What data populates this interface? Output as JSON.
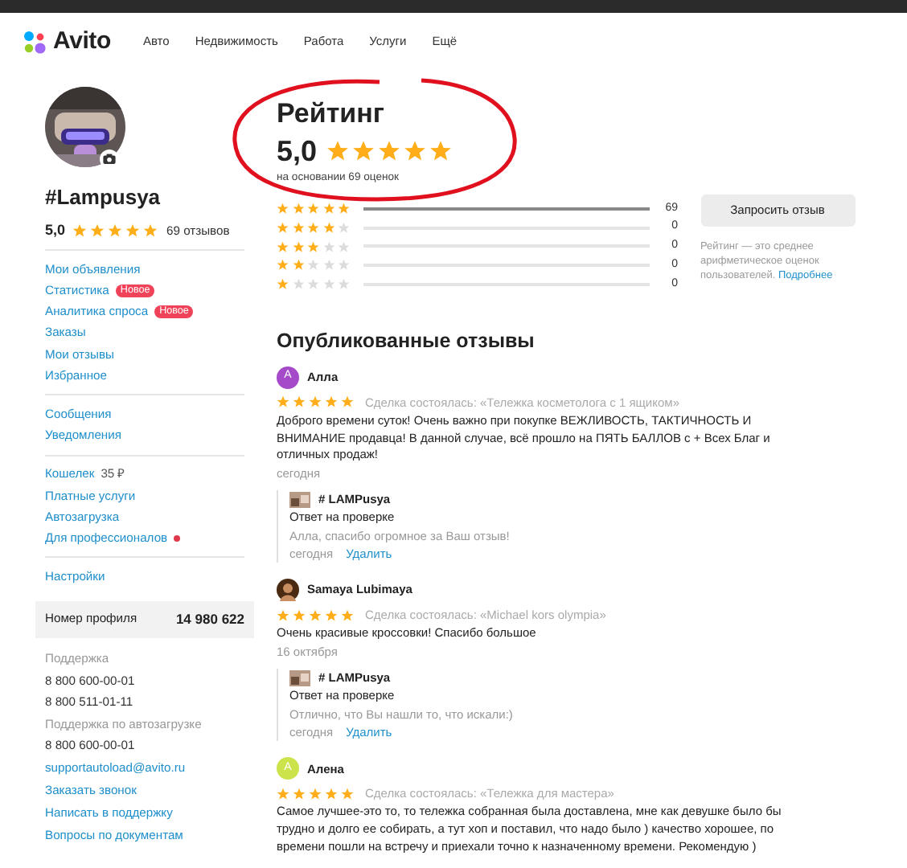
{
  "header": {
    "logo": "Avito",
    "nav": [
      "Авто",
      "Недвижимость",
      "Работа",
      "Услуги",
      "Ещё"
    ]
  },
  "profile": {
    "name": "#Lampusya",
    "score": "5,0",
    "stars": 5,
    "reviews_count": "69 отзывов"
  },
  "menu_groups": [
    [
      {
        "label": "Мои объявления"
      },
      {
        "label": "Статистика",
        "badge": "Новое"
      },
      {
        "label": "Аналитика спроса",
        "badge": "Новое"
      },
      {
        "label": "Заказы"
      },
      {
        "label": "Мои отзывы"
      },
      {
        "label": "Избранное"
      }
    ],
    [
      {
        "label": "Сообщения"
      },
      {
        "label": "Уведомления"
      }
    ],
    [
      {
        "label": "Кошелек",
        "value": "35 ₽"
      },
      {
        "label": "Платные услуги"
      },
      {
        "label": "Автозагрузка"
      },
      {
        "label": "Для профессионалов",
        "dot": true
      }
    ],
    [
      {
        "label": "Настройки"
      }
    ]
  ],
  "profile_number": {
    "label": "Номер профиля",
    "value": "14 980 622"
  },
  "support": [
    {
      "kind": "label",
      "text": "Поддержка"
    },
    {
      "kind": "phone",
      "text": "8 800 600-00-01"
    },
    {
      "kind": "phone",
      "text": "8 800 511-01-11"
    },
    {
      "kind": "label",
      "text": "Поддержка по автозагрузке"
    },
    {
      "kind": "phone",
      "text": "8 800 600-00-01"
    },
    {
      "kind": "link",
      "text": "supportautoload@avito.ru"
    },
    {
      "kind": "link",
      "text": "Заказать звонок"
    },
    {
      "kind": "link",
      "text": "Написать в поддержку"
    },
    {
      "kind": "link",
      "text": "Вопросы по документам"
    }
  ],
  "rating": {
    "title": "Рейтинг",
    "score": "5,0",
    "stars": 5,
    "caption": "на основании 69 оценок",
    "distribution": [
      {
        "stars": 5,
        "level": 1,
        "count": "69"
      },
      {
        "stars": 4,
        "level": 0,
        "count": "0"
      },
      {
        "stars": 3,
        "level": 0,
        "count": "0"
      },
      {
        "stars": 2,
        "level": 0,
        "count": "0"
      },
      {
        "stars": 1,
        "level": 0,
        "count": "0"
      }
    ],
    "button": "Запросить отзыв",
    "note": "Рейтинг — это среднее арифметическое оценок пользователей.",
    "note_link": "Подробнее"
  },
  "reviews_title": "Опубликованные отзывы",
  "reviews": [
    {
      "author": "Алла",
      "kind": "letter",
      "letter": "А",
      "color": "#a54bc9",
      "stars": 5,
      "deal": "Сделка состоялась: «Тележка косметолога с 1 ящиком»",
      "text": "Доброго времени суток! Очень важно при покупке ВЕЖЛИВОСТЬ, ТАКТИЧНОСТЬ И ВНИМАНИЕ продавца! В данной случае, всё прошло на ПЯТЬ БАЛЛОВ с + Всех Благ и отличных продаж!",
      "date": "сегодня",
      "reply": {
        "author": "# LAMPusya",
        "status": "Ответ на проверке",
        "text": "Алла, спасибо огромное за Ваш отзыв!",
        "date": "сегодня",
        "action": "Удалить"
      }
    },
    {
      "author": "Samaya Lubimaya",
      "stars": 5,
      "deal": "Сделка состоялась: «Michael kors olympia»",
      "text": "Очень красивые кроссовки! Спасибо большое",
      "date": "16 октября",
      "reply": {
        "author": "# LAMPusya",
        "status": "Ответ на проверке",
        "text": "Отлично, что Вы нашли то, что искали:)",
        "date": "сегодня",
        "action": "Удалить"
      }
    },
    {
      "author": "Алена",
      "kind": "letter",
      "letter": "А",
      "color": "#cde34c",
      "stars": 5,
      "deal": "Сделка состоялась: «Тележка для мастера»",
      "text": "Самое лучшее-это то, то тележка собранная была доставлена, мне как девушке было бы трудно и долго ее собирать, а тут хоп и поставил, что надо было ) качество хорошее, по времени пошли на встречу и приехали точно к назначенному времени. Рекомендую )"
    }
  ]
}
